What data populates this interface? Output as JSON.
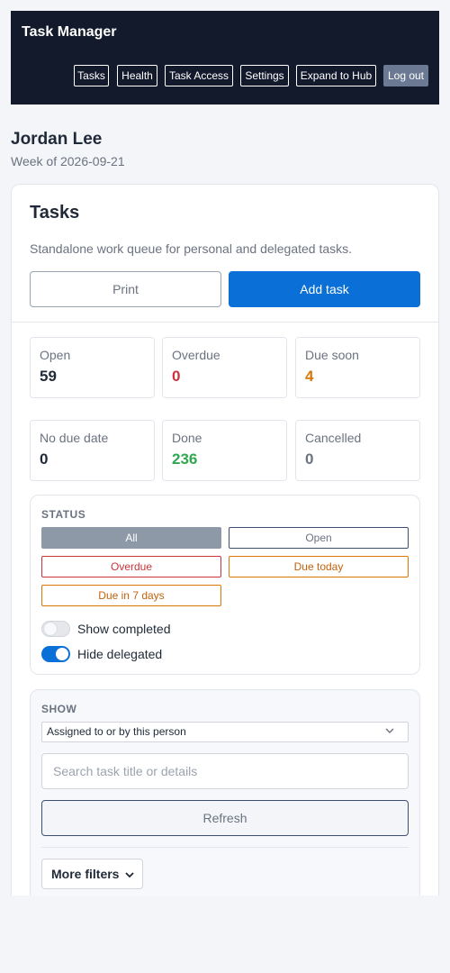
{
  "header": {
    "app_title": "Task Manager",
    "nav": [
      "Tasks",
      "Health",
      "Task Access",
      "Settings",
      "Expand to Hub"
    ],
    "logout": "Log out"
  },
  "person": {
    "name": "Jordan Lee",
    "week": "Week of 2026-09-21"
  },
  "tasks_card": {
    "title": "Tasks",
    "description": "Standalone work queue for personal and delegated tasks.",
    "print_label": "Print",
    "add_label": "Add task"
  },
  "stats": [
    {
      "label": "Open",
      "value": "59",
      "color": "#1f2937"
    },
    {
      "label": "Overdue",
      "value": "0",
      "color": "#c9343a"
    },
    {
      "label": "Due soon",
      "value": "4",
      "color": "#d97706"
    },
    {
      "label": "No due date",
      "value": "0",
      "color": "#1f2937"
    },
    {
      "label": "Done",
      "value": "236",
      "color": "#2fa84f"
    },
    {
      "label": "Cancelled",
      "value": "0",
      "color": "#6b7280"
    }
  ],
  "status": {
    "heading": "STATUS",
    "chips": [
      "All",
      "Open",
      "Overdue",
      "Due today",
      "Due in 7 days"
    ],
    "selected": "All",
    "toggles": [
      {
        "label": "Show completed",
        "on": false
      },
      {
        "label": "Hide delegated",
        "on": true
      }
    ]
  },
  "show": {
    "heading": "SHOW",
    "selected_option": "Assigned to or by this person",
    "search_placeholder": "Search task title or details",
    "refresh_label": "Refresh",
    "more_filters_label": "More filters"
  },
  "colors": {
    "header_bg": "#121a2c",
    "primary": "#0a6fd6",
    "danger": "#c9343a",
    "warning": "#d97706",
    "success": "#2fa84f"
  },
  "icons": {
    "select_chevron": "chevron-down-icon",
    "more_filters_chevron": "chevron-down-icon"
  }
}
